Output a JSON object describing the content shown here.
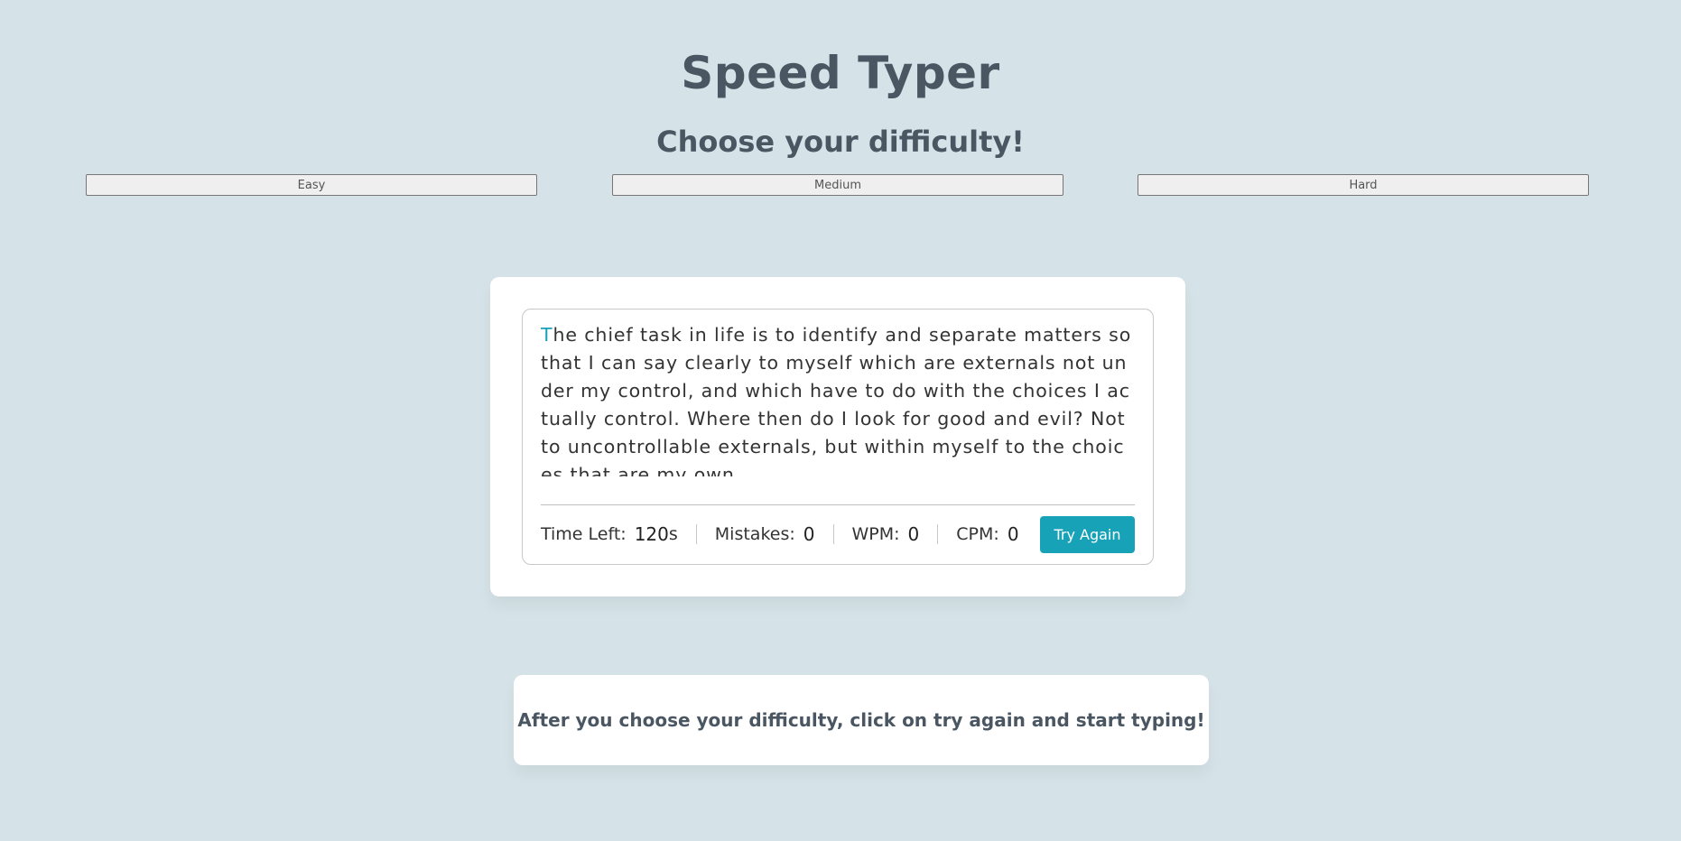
{
  "header": {
    "title": "Speed Typer",
    "subtitle": "Choose your difficulty!"
  },
  "difficulty": {
    "easy_label": "Easy",
    "medium_label": "Medium",
    "hard_label": "Hard"
  },
  "typing": {
    "active_char": "T",
    "rest_text": "he chief task in life is to identify and separate matters so that I can say clearly to myself which are externals not under my control, and which have to do with the choices I actually control. Where then do I look for good and evil? Not to uncontrollable externals, but within myself to the choices that are my own."
  },
  "stats": {
    "time_label": "Time Left:",
    "time_value": "120",
    "time_unit": "s",
    "mistakes_label": "Mistakes:",
    "mistakes_value": "0",
    "wpm_label": "WPM:",
    "wpm_value": "0",
    "cpm_label": "CPM:",
    "cpm_value": "0",
    "try_again_label": "Try Again"
  },
  "note": {
    "text": "After you choose your difficulty, click on try again and start typing!"
  },
  "colors": {
    "background": "#d5e3e8",
    "accent": "#17a2b8",
    "heading": "#4a5763"
  }
}
